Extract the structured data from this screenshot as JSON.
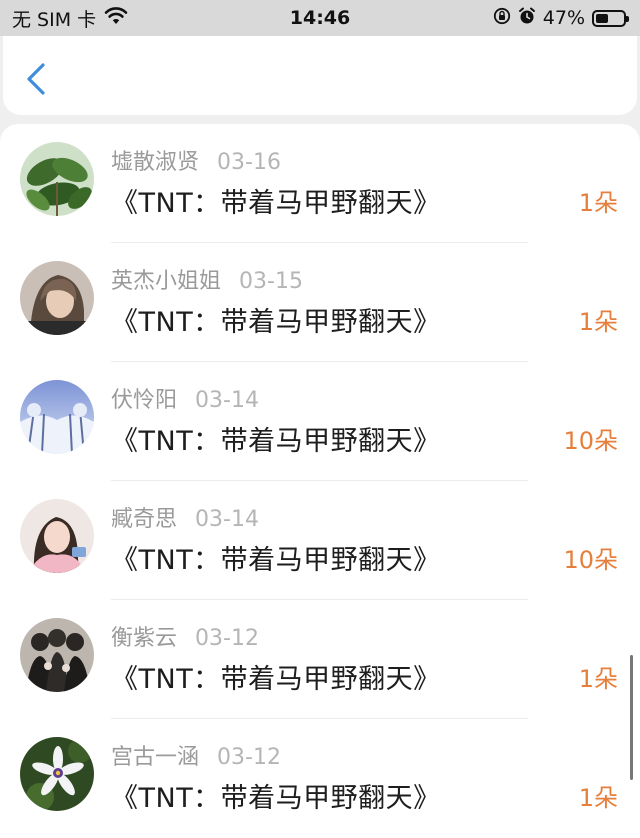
{
  "status_bar": {
    "carrier": "无 SIM 卡",
    "time": "14:46",
    "battery": "47%",
    "battery_level": 0.47,
    "icons": [
      "wifi-icon",
      "orientation-lock-icon",
      "alarm-icon",
      "battery-icon"
    ]
  },
  "nav": {
    "back_icon": "chevron-left-icon",
    "accent": "#3f8ddc"
  },
  "colors": {
    "count": "#e77f3c",
    "name": "#9a9a9a",
    "date": "#b5b5b5"
  },
  "items": [
    {
      "name": "墟散淑贤",
      "date": "03-16",
      "title": "《TNT：带着马甲野翻天》",
      "count": "1朵"
    },
    {
      "name": "英杰小姐姐",
      "date": "03-15",
      "title": "《TNT：带着马甲野翻天》",
      "count": "1朵"
    },
    {
      "name": "伏怜阳",
      "date": "03-14",
      "title": "《TNT：带着马甲野翻天》",
      "count": "10朵"
    },
    {
      "name": "臧奇思",
      "date": "03-14",
      "title": "《TNT：带着马甲野翻天》",
      "count": "10朵"
    },
    {
      "name": "衡紫云",
      "date": "03-12",
      "title": "《TNT：带着马甲野翻天》",
      "count": "1朵"
    },
    {
      "name": "宫古一涵",
      "date": "03-12",
      "title": "《TNT：带着马甲野翻天》",
      "count": "1朵"
    }
  ]
}
